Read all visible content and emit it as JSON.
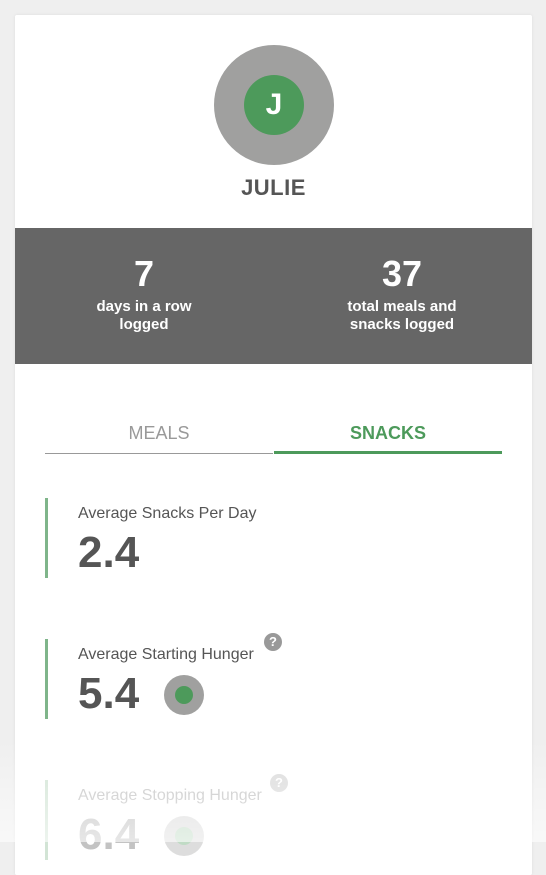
{
  "profile": {
    "avatar_initial": "J",
    "name": "JULIE"
  },
  "stats": {
    "streak": {
      "value": "7",
      "label": "days in a row logged"
    },
    "total": {
      "value": "37",
      "label": "total meals and snacks logged"
    }
  },
  "tabs": {
    "meals": "MEALS",
    "snacks": "SNACKS",
    "active": "snacks"
  },
  "metrics": [
    {
      "label": "Average Snacks Per Day",
      "value": "2.4"
    },
    {
      "label": "Average Starting Hunger",
      "value": "5.4",
      "help": "?"
    },
    {
      "label": "Average Stopping Hunger",
      "value": "6.4",
      "help": "?"
    }
  ],
  "colors": {
    "accent_green": "#4d9a5b",
    "avatar_gray": "#a0a09f",
    "stats_bg": "#666666"
  }
}
